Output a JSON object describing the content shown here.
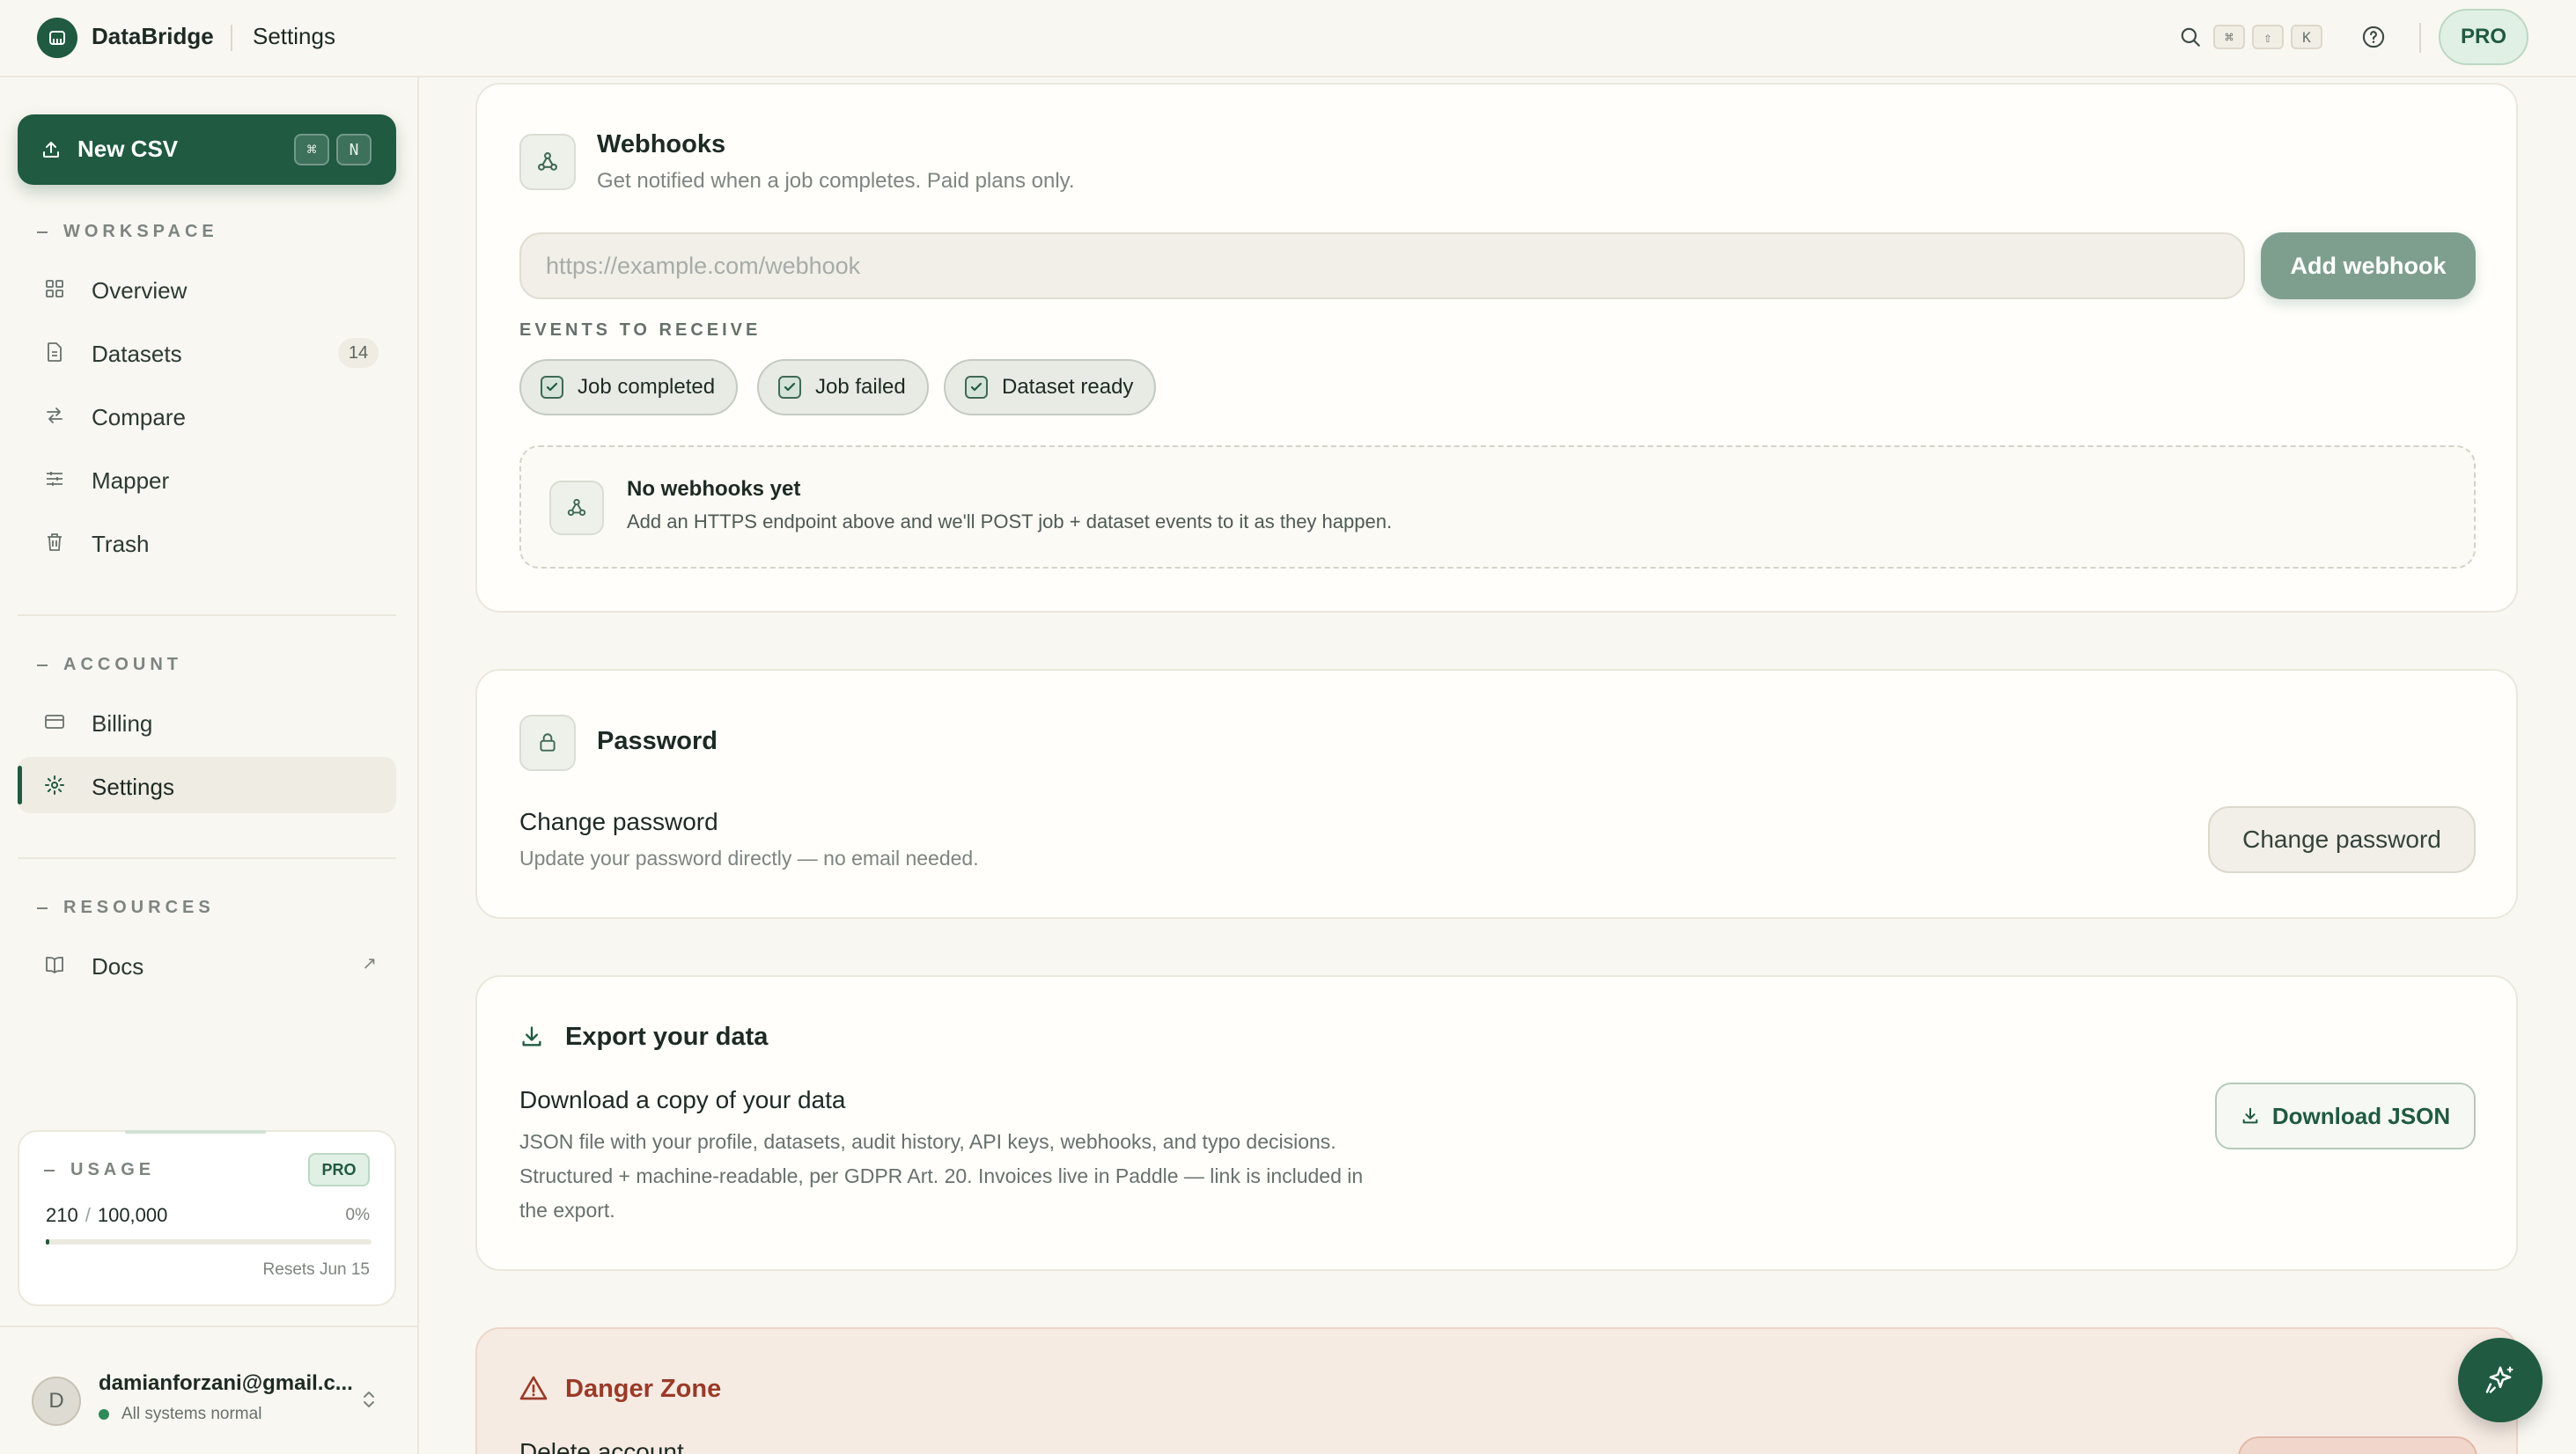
{
  "app": {
    "name": "DataBridge",
    "page": "Settings",
    "plan_badge": "PRO"
  },
  "topbar": {
    "shortcut_keys": [
      "⌘",
      "⇧",
      "K"
    ],
    "icons": [
      "search-icon",
      "help-icon"
    ]
  },
  "sidebar": {
    "new_csv": {
      "label": "New CSV",
      "keys": [
        "⌘",
        "N"
      ]
    },
    "sections": {
      "workspace": "WORKSPACE",
      "account": "ACCOUNT",
      "resources": "RESOURCES"
    },
    "workspace_items": [
      {
        "label": "Overview",
        "icon": "grid-icon"
      },
      {
        "label": "Datasets",
        "icon": "file-icon",
        "badge": "14"
      },
      {
        "label": "Compare",
        "icon": "arrows-icon"
      },
      {
        "label": "Mapper",
        "icon": "sliders-icon"
      },
      {
        "label": "Trash",
        "icon": "trash-icon"
      }
    ],
    "account_items": [
      {
        "label": "Billing",
        "icon": "card-icon"
      },
      {
        "label": "Settings",
        "icon": "gear-icon",
        "active": true
      }
    ],
    "resource_items": [
      {
        "label": "Docs",
        "icon": "book-icon",
        "external": "↗"
      }
    ],
    "usage": {
      "label": "USAGE",
      "plan": "PRO",
      "used": "210",
      "limit": "100,000",
      "percent_label": "0%",
      "progress": 0.0021,
      "reset": "Resets Jun 15"
    },
    "user": {
      "initial": "D",
      "email": "damianforzani@gmail.c...",
      "status": "All systems normal"
    }
  },
  "webhooks": {
    "title": "Webhooks",
    "subtitle": "Get notified when a job completes. Paid plans only.",
    "input_placeholder": "https://example.com/webhook",
    "add_button": "Add webhook",
    "events_label": "EVENTS TO RECEIVE",
    "events": [
      {
        "label": "Job completed",
        "checked": true
      },
      {
        "label": "Job failed",
        "checked": true
      },
      {
        "label": "Dataset ready",
        "checked": true
      }
    ],
    "empty_title": "No webhooks yet",
    "empty_text": "Add an HTTPS endpoint above and we'll POST job + dataset events to it as they happen."
  },
  "password": {
    "title": "Password",
    "row_title": "Change password",
    "row_sub": "Update your password directly — no email needed.",
    "button": "Change password"
  },
  "export": {
    "title": "Export your data",
    "row_title": "Download a copy of your data",
    "row_sub": "JSON file with your profile, datasets, audit history, API keys, webhooks, and typo decisions. Structured + machine-readable, per GDPR Art. 20. Invoices live in Paddle — link is included in the export.",
    "button": "Download JSON"
  },
  "danger": {
    "title": "Danger Zone",
    "row_title": "Delete account"
  },
  "colors": {
    "accent": "#1f5a41",
    "background": "#f9f7f1",
    "danger": "#9a3a28"
  }
}
